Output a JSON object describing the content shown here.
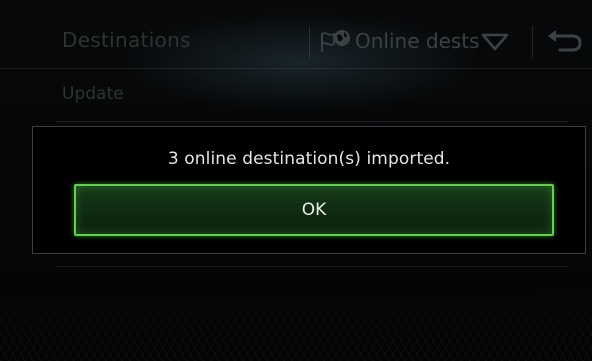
{
  "header": {
    "title": "Destinations",
    "source_select": {
      "label": "Online dests",
      "icon": "online-destinations-icon"
    },
    "back_icon": "back-arrow-icon"
  },
  "list": {
    "items": [
      {
        "label": "Update"
      }
    ]
  },
  "dialog": {
    "message": "3 online destination(s) imported.",
    "ok_label": "OK"
  },
  "colors": {
    "accent_green": "#5fd14b",
    "button_fill": "#133216",
    "dialog_border": "#3c3f41",
    "dim_text": "#2d3436",
    "dialog_text": "#e4e6e6"
  }
}
